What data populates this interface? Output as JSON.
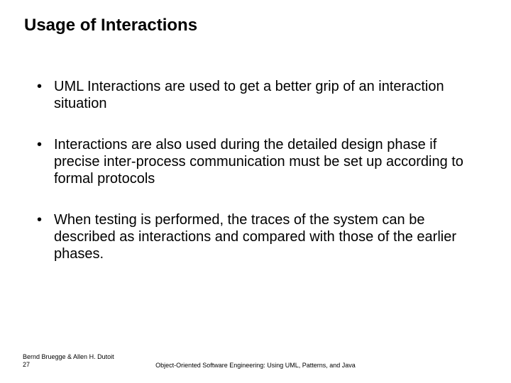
{
  "title": "Usage of Interactions",
  "bullets": [
    "UML Interactions are used to get a better grip of an interaction situation",
    "Interactions are also used during the detailed design phase if precise inter-process communication must be set up according to formal protocols",
    "When testing is performed, the traces of the system can be described as interactions and compared with those of the earlier phases."
  ],
  "footer": {
    "authors": "Bernd Bruegge & Allen H. Dutoit",
    "page": "27",
    "book": "Object-Oriented Software Engineering: Using UML, Patterns, and Java"
  }
}
